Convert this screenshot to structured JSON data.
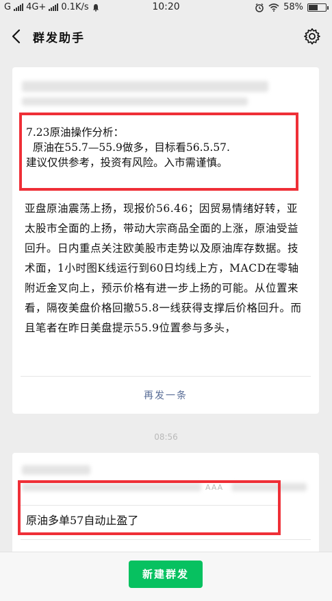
{
  "status_bar": {
    "carrier1": "G",
    "carrier2": "4G+",
    "speed": "0.1K/s",
    "time": "10:20",
    "battery": "58%",
    "battery_level": 0.58
  },
  "nav": {
    "title": "群发助手"
  },
  "messages": [
    {
      "highlight_lines": [
        "7.23原油操作分析：",
        "  原油在55.7—55.9做多，目标看56.5.57.",
        "建议仅供参考，投资有风险。入市需谨慎。"
      ],
      "body": "亚盘原油震荡上扬，现报价56.46；因贸易情绪好转，亚太股市全面的上扬，带动大宗商品全面的上涨，原油受益回升。日内重点关注欧美股市走势以及原油库存数据。技术面，1小时图K线运行到60日均线上方，MACD在零轴附近金叉向上，预示价格有进一步上扬的可能。从位置来看，隔夜美盘价格回撤55.8一线获得支撑后价格回升。而且笔者在昨日美盘提示55.9位置参与多头，",
      "resend_label": "再发一条"
    },
    {
      "aaa": "AAA",
      "text": "原油多单57自动止盈了"
    }
  ],
  "timestamp": "08:56",
  "bottom": {
    "new_button": "新建群发"
  },
  "colors": {
    "accent_green": "#07c160",
    "highlight_red": "#ef2f37",
    "link_blue": "#576b95"
  }
}
